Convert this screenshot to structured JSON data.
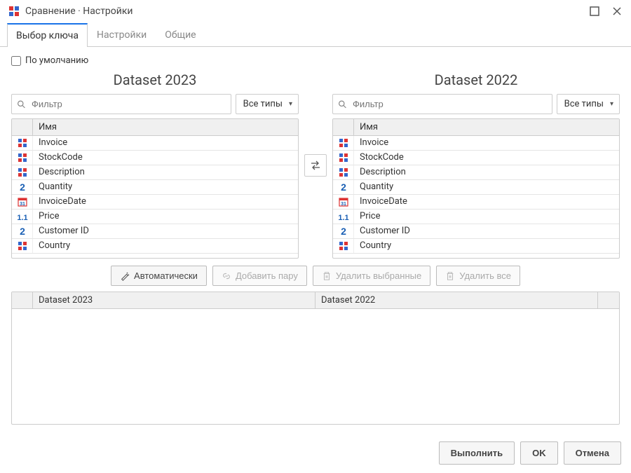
{
  "titlebar": {
    "title": "Сравнение · Настройки"
  },
  "tabs": [
    {
      "label": "Выбор ключа",
      "active": true
    },
    {
      "label": "Настройки",
      "active": false
    },
    {
      "label": "Общие",
      "active": false
    }
  ],
  "default_checkbox": {
    "label": "По умолчанию",
    "checked": false
  },
  "left_dataset": {
    "title": "Dataset 2023",
    "filter_placeholder": "Фильтр",
    "type_filter": "Все типы",
    "name_header": "Имя",
    "fields": [
      {
        "name": "Invoice",
        "type": "string"
      },
      {
        "name": "StockCode",
        "type": "string"
      },
      {
        "name": "Description",
        "type": "string"
      },
      {
        "name": "Quantity",
        "type": "int"
      },
      {
        "name": "InvoiceDate",
        "type": "date"
      },
      {
        "name": "Price",
        "type": "float"
      },
      {
        "name": "Customer ID",
        "type": "int"
      },
      {
        "name": "Country",
        "type": "string"
      }
    ]
  },
  "right_dataset": {
    "title": "Dataset 2022",
    "filter_placeholder": "Фильтр",
    "type_filter": "Все типы",
    "name_header": "Имя",
    "fields": [
      {
        "name": "Invoice",
        "type": "string"
      },
      {
        "name": "StockCode",
        "type": "string"
      },
      {
        "name": "Description",
        "type": "string"
      },
      {
        "name": "Quantity",
        "type": "int"
      },
      {
        "name": "InvoiceDate",
        "type": "date"
      },
      {
        "name": "Price",
        "type": "float"
      },
      {
        "name": "Customer ID",
        "type": "int"
      },
      {
        "name": "Country",
        "type": "string"
      }
    ]
  },
  "actions": {
    "auto": "Автоматически",
    "add_pair": "Добавить пару",
    "delete_selected": "Удалить выбранные",
    "delete_all": "Удалить все"
  },
  "pairs_table": {
    "left_header": "Dataset 2023",
    "right_header": "Dataset 2022"
  },
  "footer": {
    "execute": "Выполнить",
    "ok": "OK",
    "cancel": "Отмена"
  }
}
